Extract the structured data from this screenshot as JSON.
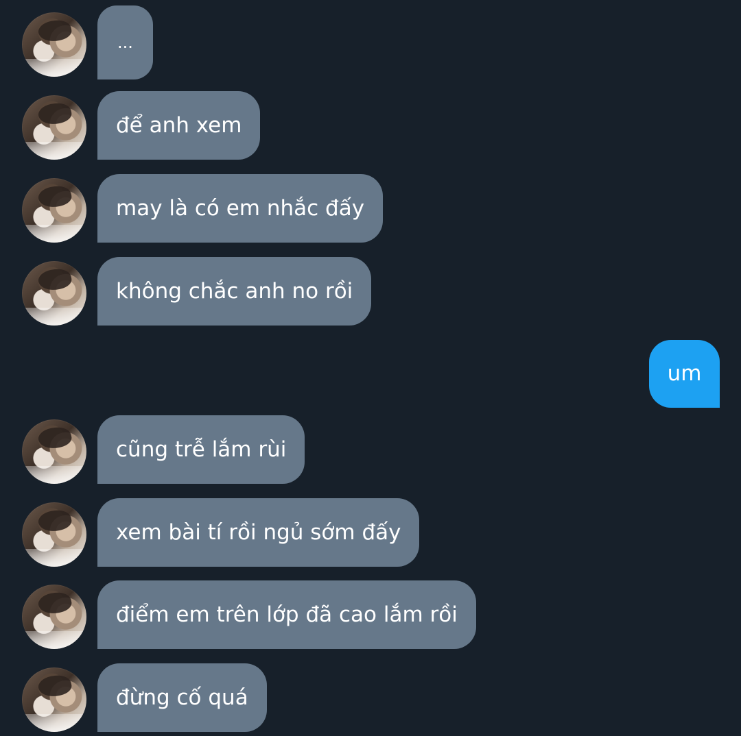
{
  "messages": [
    {
      "side": "received",
      "text": "..."
    },
    {
      "side": "received",
      "text": "để anh xem"
    },
    {
      "side": "received",
      "text": "may là có em nhắc đấy"
    },
    {
      "side": "received",
      "text": "không chắc anh no rồi"
    },
    {
      "side": "sent",
      "text": "um"
    },
    {
      "side": "received",
      "text": "cũng trễ lắm rùi"
    },
    {
      "side": "received",
      "text": "xem bài tí rồi ngủ sớm đấy"
    },
    {
      "side": "received",
      "text": "điểm em trên lớp đã cao lắm rồi"
    },
    {
      "side": "received",
      "text": "đừng cố quá"
    }
  ],
  "colors": {
    "background": "#17202a",
    "received_bubble": "#66788a",
    "sent_bubble": "#1da1f2",
    "text": "#ffffff"
  },
  "icons": {
    "avatar": "contact-avatar-photo"
  }
}
